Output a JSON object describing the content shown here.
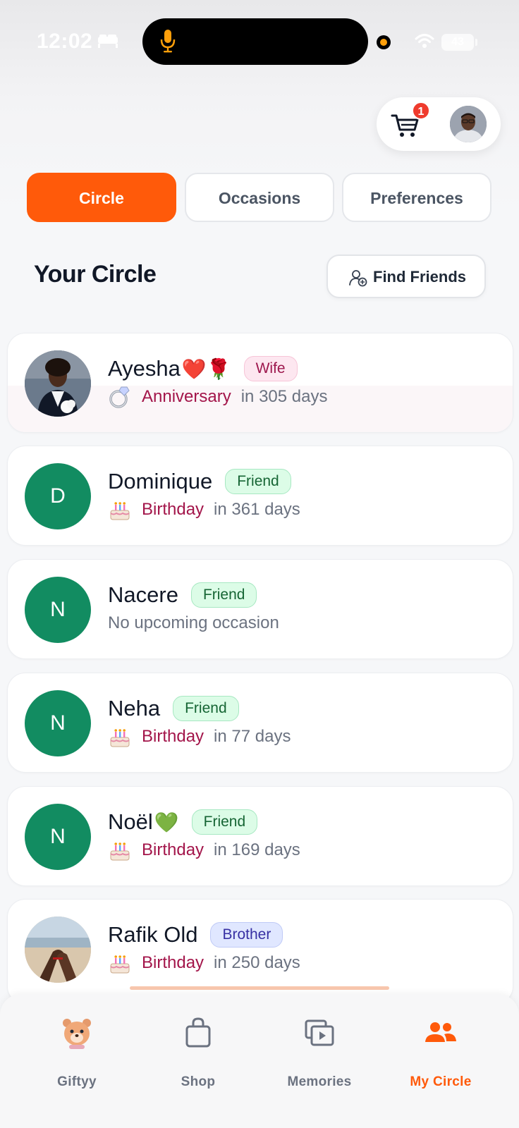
{
  "status_bar": {
    "time": "12:02",
    "battery": "43"
  },
  "header": {
    "cart_count": "1"
  },
  "tabs": [
    {
      "label": "Circle",
      "active": true
    },
    {
      "label": "Occasions",
      "active": false
    },
    {
      "label": "Preferences",
      "active": false
    }
  ],
  "section": {
    "title": "Your Circle",
    "find_friends_label": "Find Friends"
  },
  "contacts": [
    {
      "name": "Ayesha",
      "emoji": "❤️🌹",
      "relation": "Wife",
      "occasion_icon": "ring-icon",
      "occasion": "Anniversary",
      "when": "in 305 days"
    },
    {
      "name": "Dominique",
      "initial": "D",
      "relation": "Friend",
      "occasion_icon": "cake-icon",
      "occasion": "Birthday",
      "when": "in 361 days"
    },
    {
      "name": "Nacere",
      "initial": "N",
      "relation": "Friend",
      "occasion": "No upcoming occasion"
    },
    {
      "name": "Neha",
      "initial": "N",
      "relation": "Friend",
      "occasion_icon": "cake-icon",
      "occasion": "Birthday",
      "when": "in 77 days"
    },
    {
      "name": "Noël",
      "emoji": "💚",
      "initial": "N",
      "relation": "Friend",
      "occasion_icon": "cake-icon",
      "occasion": "Birthday",
      "when": "in 169 days"
    },
    {
      "name": "Rafik Old",
      "relation": "Brother",
      "occasion_icon": "cake-icon",
      "occasion": "Birthday",
      "when": "in 250 days"
    }
  ],
  "bottom_nav": [
    {
      "label": "Giftyy",
      "icon": "bear-mascot-icon",
      "active": false
    },
    {
      "label": "Shop",
      "icon": "shopping-bag-icon",
      "active": false
    },
    {
      "label": "Memories",
      "icon": "video-stack-icon",
      "active": false
    },
    {
      "label": "My Circle",
      "icon": "people-icon",
      "active": true
    }
  ],
  "colors": {
    "accent": "#ff5a0a",
    "avatar_green": "#128c61",
    "occasion_text": "#a3154a",
    "badge_red": "#ef3b2d"
  }
}
